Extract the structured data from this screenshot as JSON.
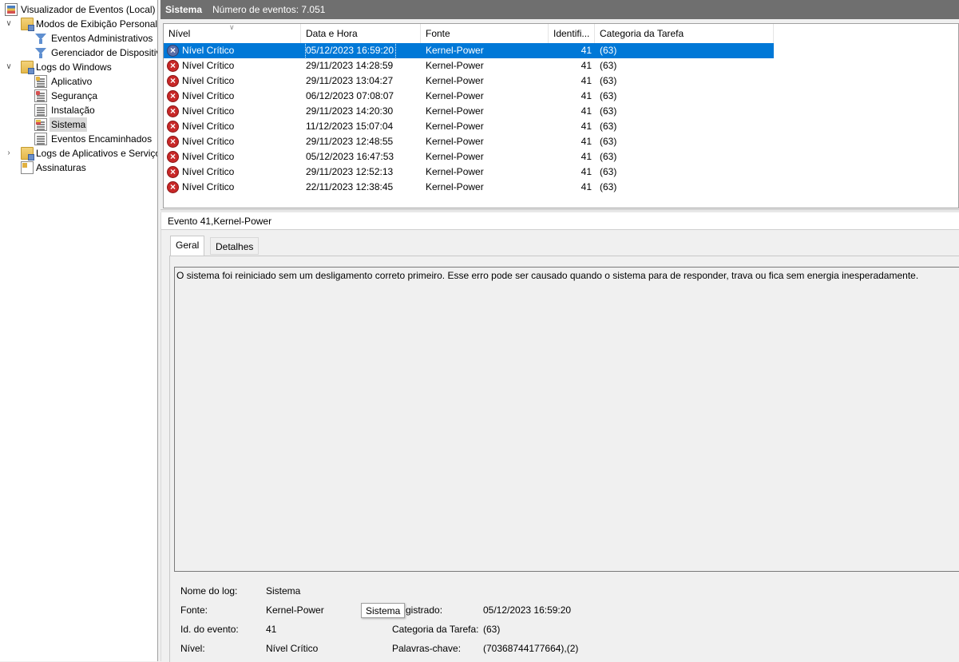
{
  "tree": {
    "root": "Visualizador de Eventos (Local)",
    "custom_views": "Modos de Exibição Personalizados",
    "custom_children": [
      "Eventos Administrativos",
      "Gerenciador de Dispositivos"
    ],
    "windows_logs": "Logs do Windows",
    "windows_children": [
      "Aplicativo",
      "Segurança",
      "Instalação",
      "Sistema",
      "Eventos Encaminhados"
    ],
    "app_services": "Logs de Aplicativos e Serviços",
    "subscriptions": "Assinaturas",
    "selected": "Sistema"
  },
  "header": {
    "log_name": "Sistema",
    "event_count": "Número de eventos: 7.051"
  },
  "list": {
    "columns": [
      "Nível",
      "Data e Hora",
      "Fonte",
      "Identifi...",
      "Categoria da Tarefa"
    ],
    "rows": [
      {
        "level": "Nível Crítico",
        "date": "05/12/2023 16:59:20",
        "source": "Kernel-Power",
        "id": "41",
        "category": "(63)"
      },
      {
        "level": "Nível Crítico",
        "date": "29/11/2023 14:28:59",
        "source": "Kernel-Power",
        "id": "41",
        "category": "(63)"
      },
      {
        "level": "Nível Crítico",
        "date": "29/11/2023 13:04:27",
        "source": "Kernel-Power",
        "id": "41",
        "category": "(63)"
      },
      {
        "level": "Nível Crítico",
        "date": "06/12/2023 07:08:07",
        "source": "Kernel-Power",
        "id": "41",
        "category": "(63)"
      },
      {
        "level": "Nível Crítico",
        "date": "29/11/2023 14:20:30",
        "source": "Kernel-Power",
        "id": "41",
        "category": "(63)"
      },
      {
        "level": "Nível Crítico",
        "date": "11/12/2023 15:07:04",
        "source": "Kernel-Power",
        "id": "41",
        "category": "(63)"
      },
      {
        "level": "Nível Crítico",
        "date": "29/11/2023 12:48:55",
        "source": "Kernel-Power",
        "id": "41",
        "category": "(63)"
      },
      {
        "level": "Nível Crítico",
        "date": "05/12/2023 16:47:53",
        "source": "Kernel-Power",
        "id": "41",
        "category": "(63)"
      },
      {
        "level": "Nível Crítico",
        "date": "29/11/2023 12:52:13",
        "source": "Kernel-Power",
        "id": "41",
        "category": "(63)"
      },
      {
        "level": "Nível Crítico",
        "date": "22/11/2023 12:38:45",
        "source": "Kernel-Power",
        "id": "41",
        "category": "(63)"
      }
    ]
  },
  "detail": {
    "title": "Evento 41,Kernel-Power",
    "tabs": [
      "Geral",
      "Detalhes"
    ],
    "description": "O sistema foi reiniciado sem um desligamento correto primeiro. Esse erro pode ser causado quando o sistema para de responder, trava ou fica sem energia inesperadamente.",
    "fields": {
      "log_label": "Nome do log:",
      "log_value": "Sistema",
      "source_label": "Fonte:",
      "source_value": "Kernel-Power",
      "registered_label_visible": "gistrado:",
      "registered_value": "05/12/2023 16:59:20",
      "event_id_label": "Id. do evento:",
      "event_id_value": "41",
      "task_cat_label": "Categoria da Tarefa:",
      "task_cat_value": "(63)",
      "level_label": "Nível:",
      "level_value": "Nível Crítico",
      "keywords_label": "Palavras-chave:",
      "keywords_value": "(70368744177664),(2)"
    },
    "tooltip": "Sistema"
  },
  "colors": {
    "selection": "#0078d7",
    "header_bar": "#6f6f6f",
    "error": "#c82828"
  }
}
